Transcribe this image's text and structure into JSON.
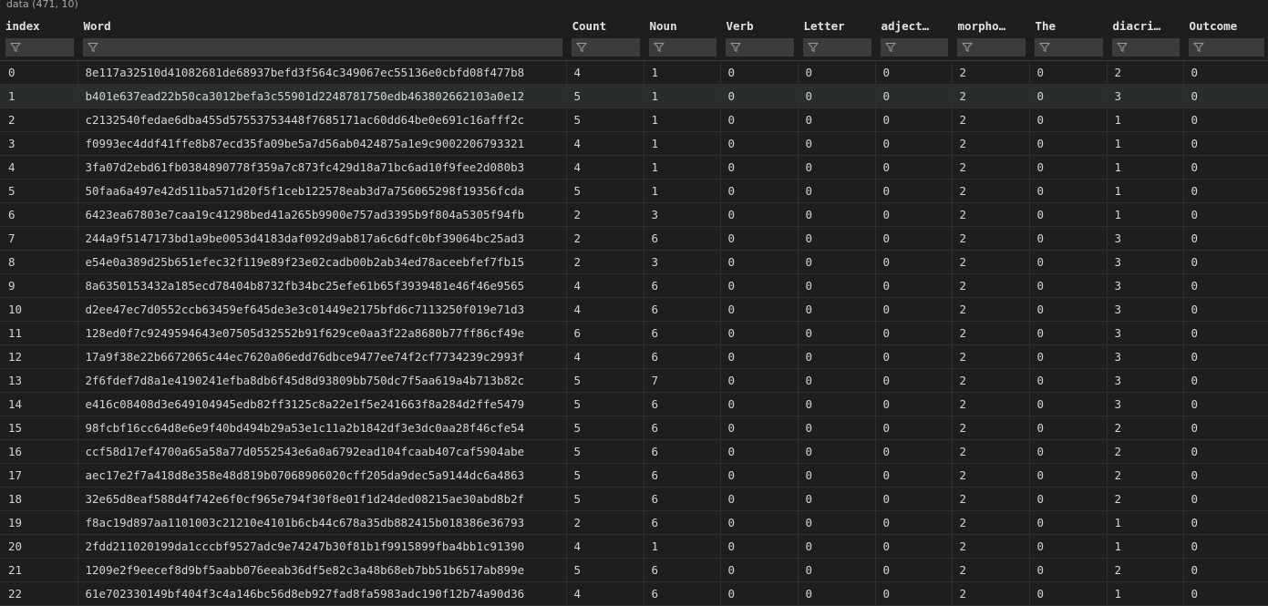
{
  "breadcrumb": {
    "chevron": "›",
    "path": "data (471, 10)"
  },
  "grid": {
    "columns": [
      "index",
      "Word",
      "Count",
      "Noun",
      "Verb",
      "Letter",
      "adject…",
      "morpho…",
      "The",
      "diacri…",
      "Outcome"
    ],
    "rows": [
      [
        "0",
        "8e117a32510d41082681de68937befd3f564c349067ec55136e0cbfd08f477b8",
        "4",
        "1",
        "0",
        "0",
        "0",
        "2",
        "0",
        "2",
        "0"
      ],
      [
        "1",
        "b401e637ead22b50ca3012befa3c55901d2248781750edb463802662103a0e12",
        "5",
        "1",
        "0",
        "0",
        "0",
        "2",
        "0",
        "3",
        "0"
      ],
      [
        "2",
        "c2132540fedae6dba455d57553753448f7685171ac60dd64be0e691c16afff2c",
        "5",
        "1",
        "0",
        "0",
        "0",
        "2",
        "0",
        "1",
        "0"
      ],
      [
        "3",
        "f0993ec4ddf41ffe8b87ecd35fa09be5a7d56ab0424875a1e9c9002206793321",
        "4",
        "1",
        "0",
        "0",
        "0",
        "2",
        "0",
        "1",
        "0"
      ],
      [
        "4",
        "3fa07d2ebd61fb0384890778f359a7c873fc429d18a71bc6ad10f9fee2d080b3",
        "4",
        "1",
        "0",
        "0",
        "0",
        "2",
        "0",
        "1",
        "0"
      ],
      [
        "5",
        "50faa6a497e42d511ba571d20f5f1ceb122578eab3d7a756065298f19356fcda",
        "5",
        "1",
        "0",
        "0",
        "0",
        "2",
        "0",
        "1",
        "0"
      ],
      [
        "6",
        "6423ea67803e7caa19c41298bed41a265b9900e757ad3395b9f804a5305f94fb",
        "2",
        "3",
        "0",
        "0",
        "0",
        "2",
        "0",
        "1",
        "0"
      ],
      [
        "7",
        "244a9f5147173bd1a9be0053d4183daf092d9ab817a6c6dfc0bf39064bc25ad3",
        "2",
        "6",
        "0",
        "0",
        "0",
        "2",
        "0",
        "3",
        "0"
      ],
      [
        "8",
        "e54e0a389d25b651efec32f119e89f23e02cadb00b2ab34ed78aceebfef7fb15",
        "2",
        "3",
        "0",
        "0",
        "0",
        "2",
        "0",
        "3",
        "0"
      ],
      [
        "9",
        "8a6350153432a185ecd78404b8732fb34bc25efe61b65f3939481e46f46e9565",
        "4",
        "6",
        "0",
        "0",
        "0",
        "2",
        "0",
        "3",
        "0"
      ],
      [
        "10",
        "d2ee47ec7d0552ccb63459ef645de3e3c01449e2175bfd6c7113250f019e71d3",
        "4",
        "6",
        "0",
        "0",
        "0",
        "2",
        "0",
        "3",
        "0"
      ],
      [
        "11",
        "128ed0f7c9249594643e07505d32552b91f629ce0aa3f22a8680b77ff86cf49e",
        "6",
        "6",
        "0",
        "0",
        "0",
        "2",
        "0",
        "3",
        "0"
      ],
      [
        "12",
        "17a9f38e22b6672065c44ec7620a06edd76dbce9477ee74f2cf7734239c2993f",
        "4",
        "6",
        "0",
        "0",
        "0",
        "2",
        "0",
        "3",
        "0"
      ],
      [
        "13",
        "2f6fdef7d8a1e4190241efba8db6f45d8d93809bb750dc7f5aa619a4b713b82c",
        "5",
        "7",
        "0",
        "0",
        "0",
        "2",
        "0",
        "3",
        "0"
      ],
      [
        "14",
        "e416c08408d3e649104945edb82ff3125c8a22e1f5e241663f8a284d2ffe5479",
        "5",
        "6",
        "0",
        "0",
        "0",
        "2",
        "0",
        "3",
        "0"
      ],
      [
        "15",
        "98fcbf16cc64d8e6e9f40bd494b29a53e1c11a2b1842df3e3dc0aa28f46cfe54",
        "5",
        "6",
        "0",
        "0",
        "0",
        "2",
        "0",
        "2",
        "0"
      ],
      [
        "16",
        "ccf58d17ef4700a65a58a77d0552543e6a0a6792ead104fcaab407caf5904abe",
        "5",
        "6",
        "0",
        "0",
        "0",
        "2",
        "0",
        "2",
        "0"
      ],
      [
        "17",
        "aec17e2f7a418d8e358e48d819b07068906020cff205da9dec5a9144dc6a4863",
        "5",
        "6",
        "0",
        "0",
        "0",
        "2",
        "0",
        "2",
        "0"
      ],
      [
        "18",
        "32e65d8eaf588d4f742e6f0cf965e794f30f8e01f1d24ded08215ae30abd8b2f",
        "5",
        "6",
        "0",
        "0",
        "0",
        "2",
        "0",
        "2",
        "0"
      ],
      [
        "19",
        "f8ac19d897aa1101003c21210e4101b6cb44c678a35db882415b018386e36793",
        "2",
        "6",
        "0",
        "0",
        "0",
        "2",
        "0",
        "1",
        "0"
      ],
      [
        "20",
        "2fdd211020199da1cccbf9527adc9e74247b30f81b1f9915899fba4bb1c91390",
        "4",
        "1",
        "0",
        "0",
        "0",
        "2",
        "0",
        "1",
        "0"
      ],
      [
        "21",
        "1209e2f9eecef8d9bf5aabb076eeab36df5e82c3a48b68eb7bb51b6517ab899e",
        "5",
        "6",
        "0",
        "0",
        "0",
        "2",
        "0",
        "2",
        "0"
      ],
      [
        "22",
        "61e702330149bf404f3c4a146bc56d8eb927fad8fa5983adc190f12b74a90d36",
        "4",
        "6",
        "0",
        "0",
        "0",
        "2",
        "0",
        "1",
        "0"
      ]
    ],
    "selected_row": 1,
    "filter_icon": "filter-icon"
  },
  "colors": {
    "background": "#1e1e1e",
    "filter_box": "#3c3c3c",
    "selected_row": "#2a2d2e",
    "text": "#d4d4d4"
  }
}
